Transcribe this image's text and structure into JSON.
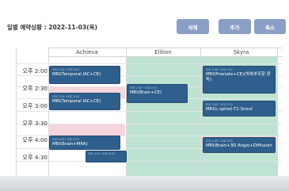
{
  "page": {
    "title": "일별 예약상황 : 2022-11-03(목)",
    "buttons": {
      "delete": "삭제",
      "add": "추가",
      "shrink": "축소"
    }
  },
  "columns": [
    "Achieva",
    "Elition",
    "Skyra"
  ],
  "times": [
    "오후 2:00",
    "오후 2:30",
    "오후 3:00",
    "오후 3:30",
    "오후 4:00",
    "오후 4:30"
  ],
  "events": [
    {
      "subtitle": "오후 2:00~오후 2:40",
      "title": "MRI(Temporal IAC+CE)"
    },
    {
      "subtitle": "오후 2:00~오후 2:40",
      "title": "MRI(Prostate+CE)(하복부포함 판독)"
    },
    {
      "subtitle": "오후 2:30~오후 3:00",
      "title": "MRI(Brain+CE)"
    },
    {
      "subtitle": "오후 2:50~오후 3:30",
      "title": "MRI(Temporal IAC+CE)"
    },
    {
      "subtitle": "오후 3:00~오후 3:30",
      "title": "MRI(L-spine)-T2-Scout"
    },
    {
      "subtitle": "오후 4:00~오후 4:30",
      "title": "MRI(Brain+MRA)"
    },
    {
      "subtitle": "오후 4:00~오후 4:40",
      "title": "MRI(Brain+3D Angio+Diffusion"
    },
    {
      "subtitle": "오후 4:20~오후 4:40",
      "title": ""
    }
  ],
  "colors": {
    "event": "#2f5f8c",
    "button": "#8b9fc6",
    "elition_bg": "#bfe3d2",
    "skyra_bg": "#bfe3d2",
    "blocked_bg": "#f4d6dc"
  }
}
